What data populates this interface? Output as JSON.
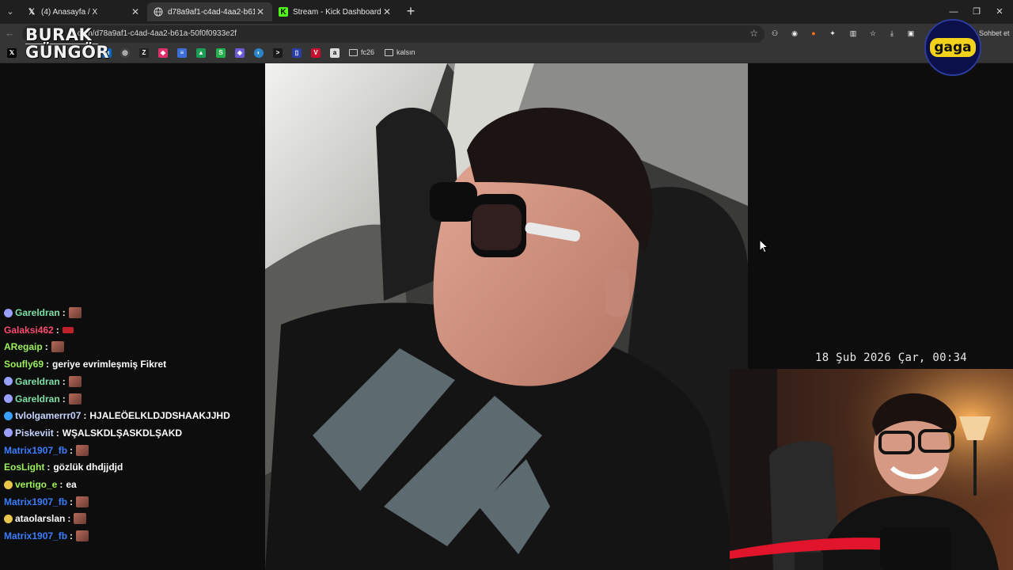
{
  "tabs": [
    {
      "label": "(4) Anasayfa / X",
      "icon": "x-logo-icon",
      "active": false
    },
    {
      "label": "d78a9af1-c4ad-4aa2-b61a-50f0f0",
      "icon": "globe-icon",
      "active": true
    },
    {
      "label": "Stream - Kick Dashboard",
      "icon": "kick-logo-icon",
      "active": false
    }
  ],
  "address": {
    "url": "x.com/d78a9af1-c4ad-4aa2-b61a-50f0f0933e2f"
  },
  "toolbar": {
    "sohbet_label": "Sohbet et"
  },
  "bookmarks": {
    "folders": [
      "fc26",
      "kalsın"
    ]
  },
  "watermark": {
    "line1": "BURAK",
    "line2": "GÜNGÖR"
  },
  "gaga_logo": {
    "text": "gaga"
  },
  "chat": {
    "messages": [
      {
        "user": "Gareldran",
        "color": "#7ee0a6",
        "badge": "#9aa0ff",
        "text": "",
        "emote": "face"
      },
      {
        "user": "Galaksi462",
        "color": "#ff4b6e",
        "badge": "",
        "text": "",
        "emote": "red"
      },
      {
        "user": "ARegaip",
        "color": "#9cf05a",
        "badge": "",
        "text": "",
        "emote": "face"
      },
      {
        "user": "Soufly69",
        "color": "#9cf05a",
        "badge": "",
        "text": "geriye evrimleşmiş Fikret",
        "emote": ""
      },
      {
        "user": "Gareldran",
        "color": "#7ee0a6",
        "badge": "#9aa0ff",
        "text": "",
        "emote": "face"
      },
      {
        "user": "Gareldran",
        "color": "#7ee0a6",
        "badge": "#9aa0ff",
        "text": "",
        "emote": "face"
      },
      {
        "user": "tvlolgamerrr07",
        "color": "#c6d4ff",
        "badge": "#3aa0ff",
        "text": "HJALEÖELKLDJDSHAAKJJHD",
        "emote": ""
      },
      {
        "user": "Piskeviit",
        "color": "#c6d4ff",
        "badge": "#9aa0ff",
        "text": "WŞALSKDLŞASKDLŞAKD",
        "emote": ""
      },
      {
        "user": "Matrix1907_fb",
        "color": "#3a7dff",
        "badge": "",
        "text": "",
        "emote": "face"
      },
      {
        "user": "EosLight",
        "color": "#9cf05a",
        "badge": "",
        "text": "gözlük dhdjjdjd",
        "emote": ""
      },
      {
        "user": "vertigo_e",
        "color": "#9cf05a",
        "badge": "#e8c64a",
        "text": "ea",
        "emote": ""
      },
      {
        "user": "Matrix1907_fb",
        "color": "#3a7dff",
        "badge": "",
        "text": "",
        "emote": "face"
      },
      {
        "user": "ataolarslan",
        "color": "#ffffff",
        "badge": "#e8c64a",
        "text": "",
        "emote": "face"
      },
      {
        "user": "Matrix1907_fb",
        "color": "#3a7dff",
        "badge": "",
        "text": "",
        "emote": "face"
      }
    ]
  },
  "overlay": {
    "datetime": "18 Şub 2026 Çar, 00:34"
  }
}
